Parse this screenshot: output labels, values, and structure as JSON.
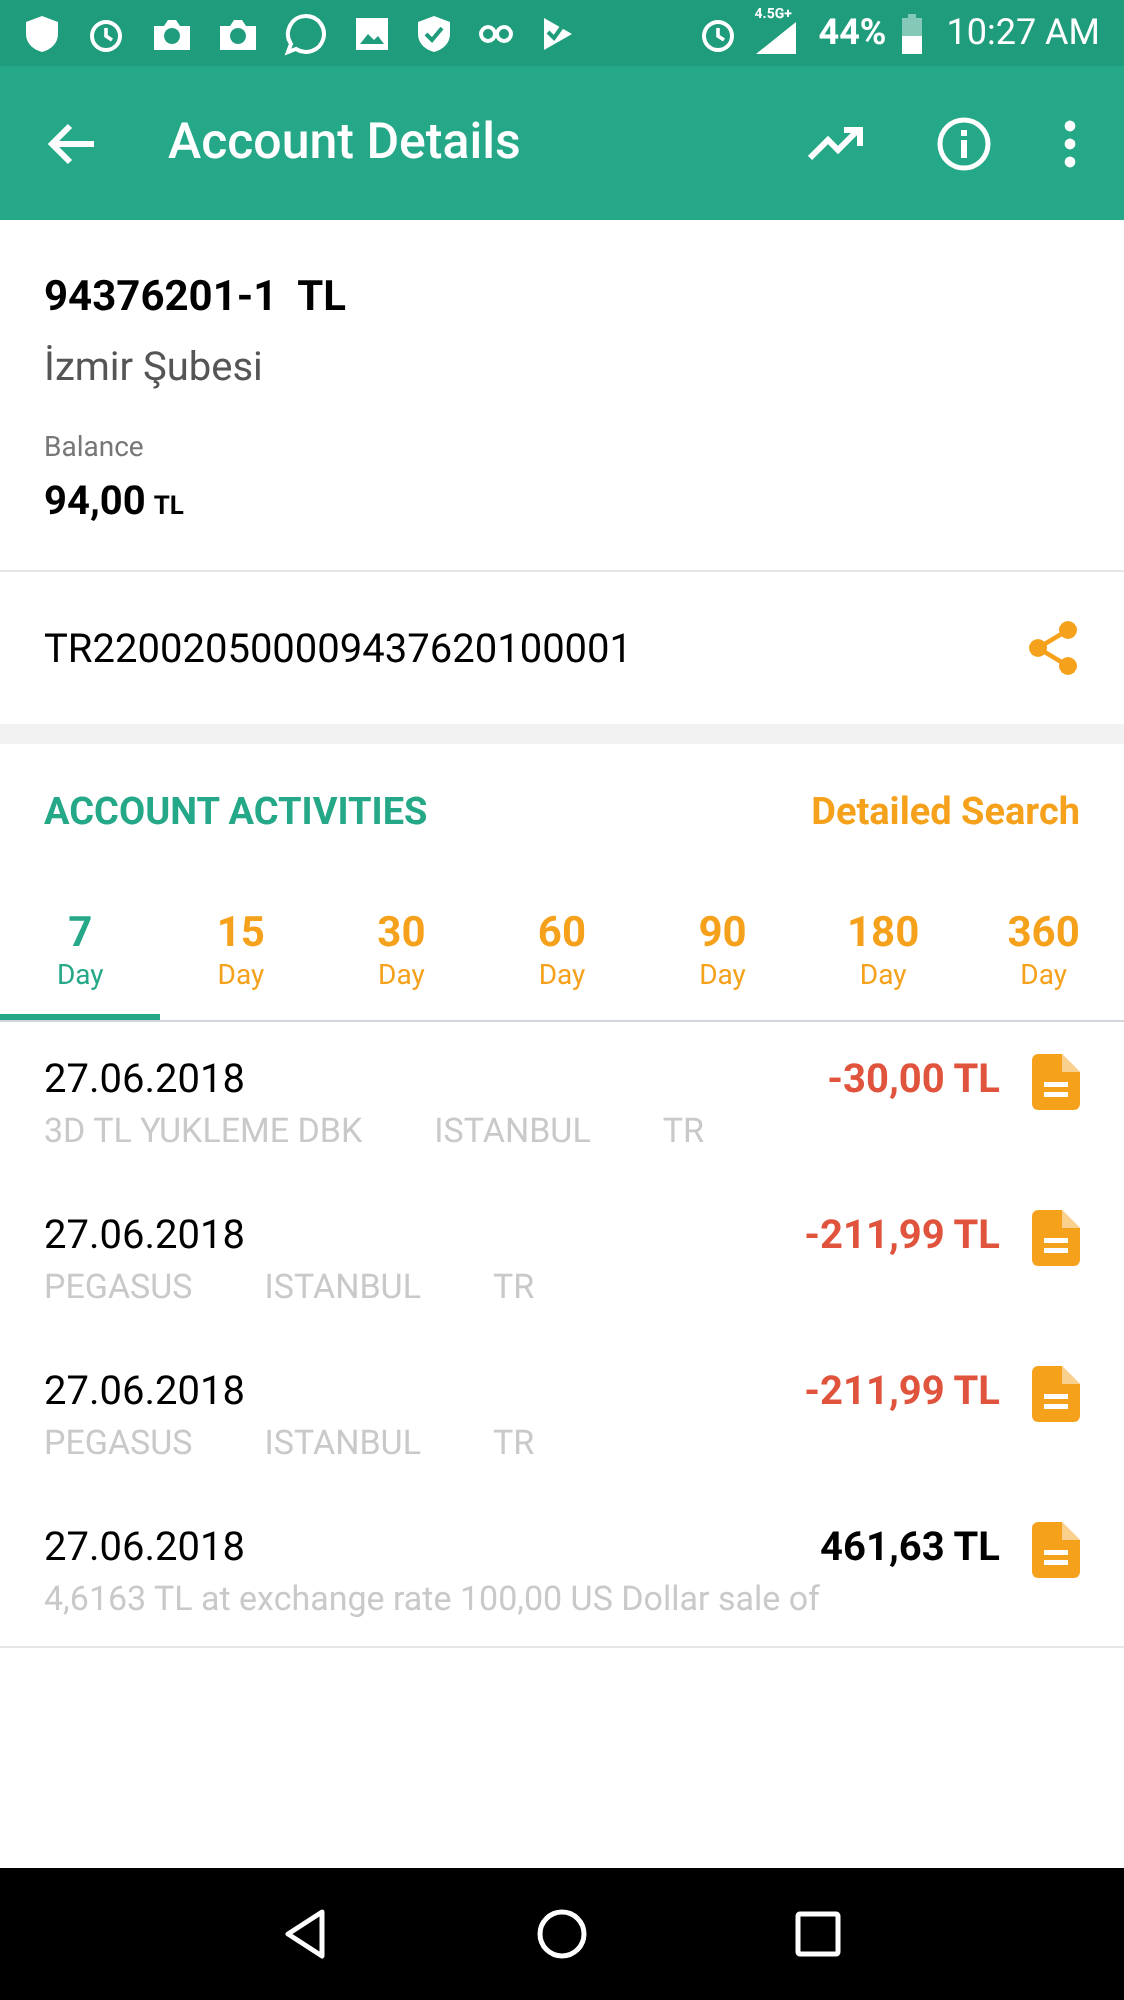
{
  "status_bar": {
    "network": "4.5G+",
    "battery": "44%",
    "time": "10:27 AM"
  },
  "header": {
    "title": "Account Details"
  },
  "account": {
    "number": "94376201-1  TL",
    "branch": "İzmir Şubesi",
    "balance_label": "Balance",
    "balance": "94,00",
    "balance_currency": "TL"
  },
  "iban": "TR220020500009437620100001",
  "activities": {
    "title": "ACCOUNT ACTIVITIES",
    "search_link": "Detailed Search"
  },
  "tabs": [
    {
      "number": "7",
      "unit": "Day",
      "selected": true
    },
    {
      "number": "15",
      "unit": "Day",
      "selected": false
    },
    {
      "number": "30",
      "unit": "Day",
      "selected": false
    },
    {
      "number": "60",
      "unit": "Day",
      "selected": false
    },
    {
      "number": "90",
      "unit": "Day",
      "selected": false
    },
    {
      "number": "180",
      "unit": "Day",
      "selected": false
    },
    {
      "number": "360",
      "unit": "Day",
      "selected": false
    }
  ],
  "transactions": [
    {
      "date": "27.06.2018",
      "amount": "-30,00 TL",
      "kind": "debit",
      "description": [
        "3D TL YUKLEME DBK",
        "ISTANBUL",
        "TR"
      ]
    },
    {
      "date": "27.06.2018",
      "amount": "-211,99 TL",
      "kind": "debit",
      "description": [
        "PEGASUS",
        "ISTANBUL",
        "TR"
      ]
    },
    {
      "date": "27.06.2018",
      "amount": "-211,99 TL",
      "kind": "debit",
      "description": [
        "PEGASUS",
        "ISTANBUL",
        "TR"
      ]
    },
    {
      "date": "27.06.2018",
      "amount": "461,63 TL",
      "kind": "credit",
      "description": [
        "4,6163 TL at exchange rate 100,00 US Dollar sale of"
      ]
    }
  ]
}
